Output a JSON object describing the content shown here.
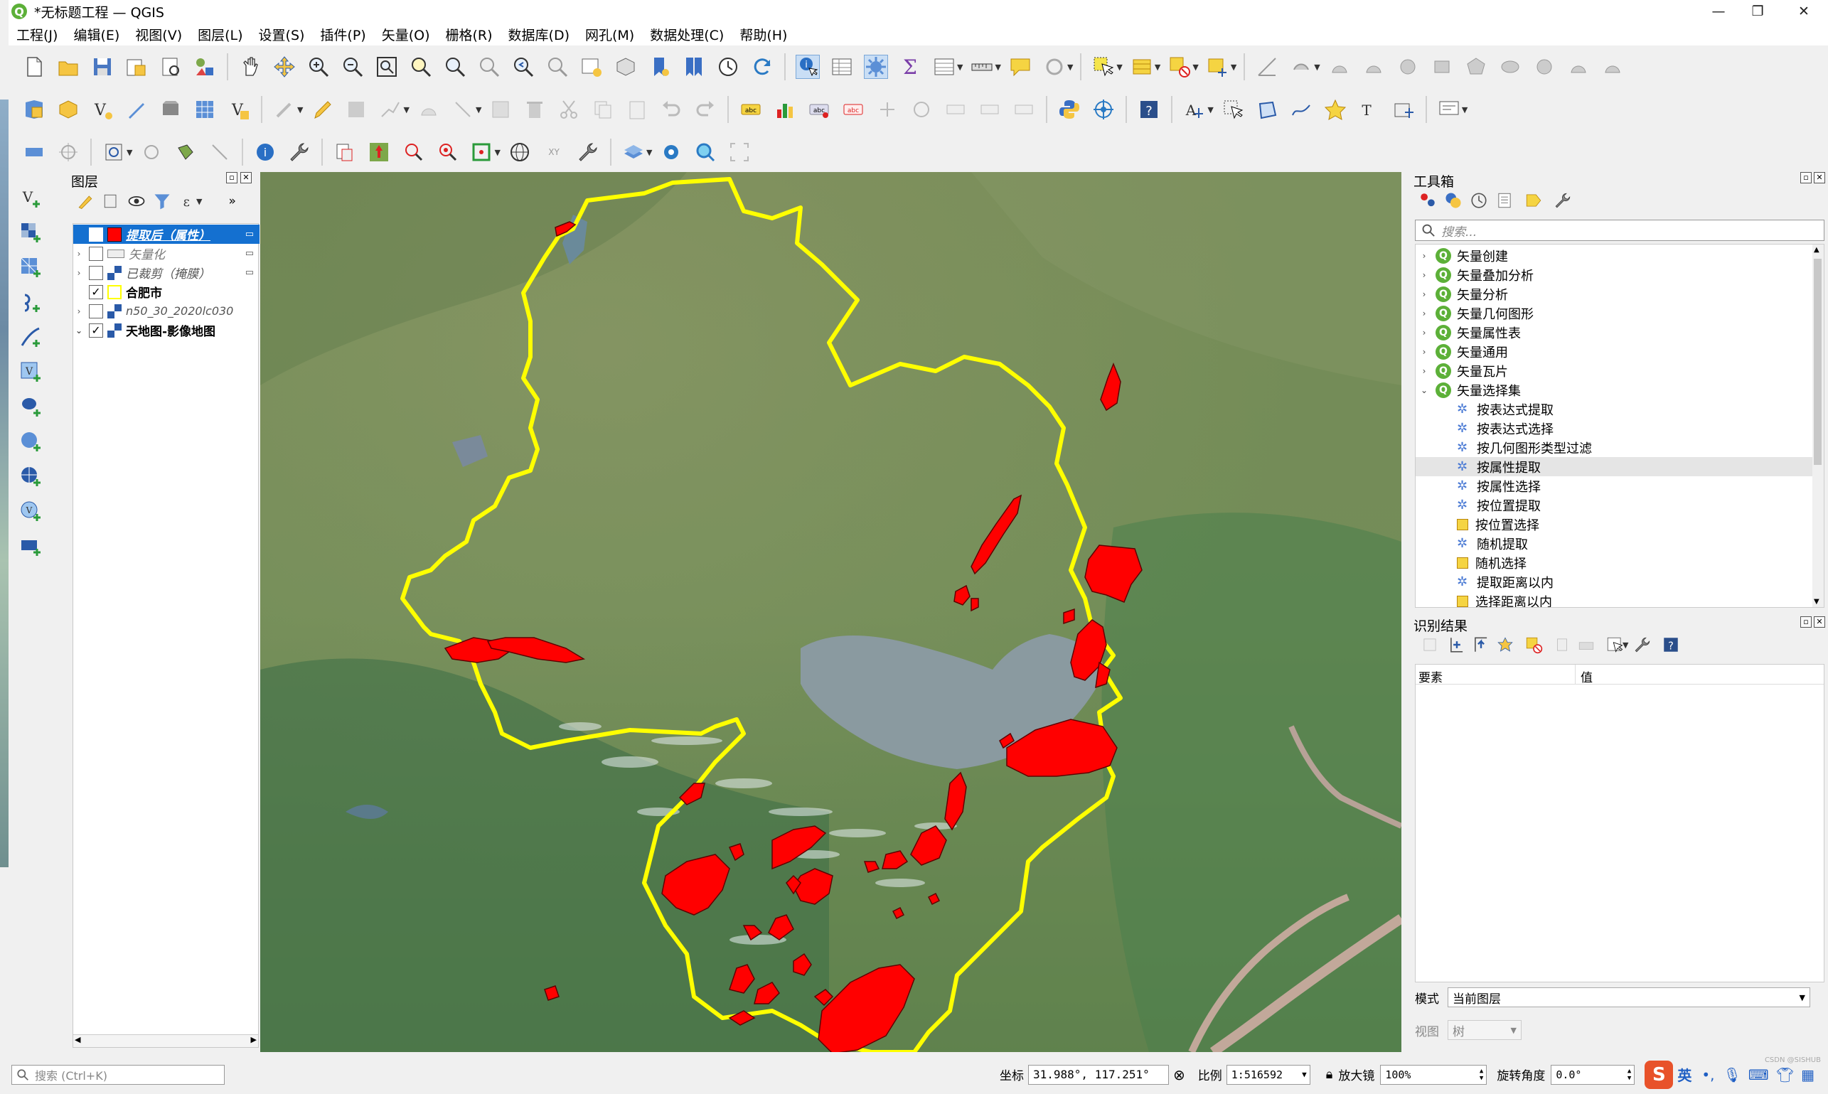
{
  "window": {
    "title": "*无标题工程 — QGIS",
    "min": "—",
    "max": "❐",
    "close": "✕"
  },
  "menu": [
    "工程(J)",
    "编辑(E)",
    "视图(V)",
    "图层(L)",
    "设置(S)",
    "插件(P)",
    "矢量(O)",
    "栅格(R)",
    "数据库(D)",
    "网孔(M)",
    "数据处理(C)",
    "帮助(H)"
  ],
  "layers_panel": {
    "title": "图层",
    "items": [
      {
        "name": "提取后（属性）",
        "checked": true,
        "selected": true,
        "color": "#ff0000"
      },
      {
        "name": "矢量化",
        "checked": false,
        "italic": true
      },
      {
        "name": "已裁剪（掩膜）",
        "checked": false,
        "italic": true
      },
      {
        "name": "合肥市",
        "checked": true,
        "bold": true,
        "color": "#ffff00"
      },
      {
        "name": "n50_30_2020lc030",
        "checked": false,
        "italic": true
      },
      {
        "name": "天地图-影像地图",
        "checked": true,
        "bold": true
      }
    ]
  },
  "toolbox": {
    "title": "工具箱",
    "search_placeholder": "搜索...",
    "groups": [
      "矢量创建",
      "矢量叠加分析",
      "矢量分析",
      "矢量几何图形",
      "矢量属性表",
      "矢量通用",
      "矢量瓦片",
      "矢量选择集"
    ],
    "tools": [
      "按表达式提取",
      "按表达式选择",
      "按几何图形类型过滤",
      "按属性提取",
      "按属性选择",
      "按位置提取",
      "按位置选择",
      "随机提取",
      "随机选择",
      "提取距离以内",
      "选择距离以内"
    ],
    "highlighted_tool": "按属性提取"
  },
  "identify": {
    "title": "识别结果",
    "col_feature": "要素",
    "col_value": "值",
    "mode_label": "模式",
    "mode_value": "当前图层",
    "view_label": "视图",
    "view_value": "树"
  },
  "status": {
    "search_placeholder": "搜索 (Ctrl+K)",
    "coord_label": "坐标",
    "coord_value": "31.988°, 117.251°",
    "scale_label": "比例",
    "scale_value": "1:516592",
    "magnifier_label": "放大镜",
    "magnifier_value": "100%",
    "rotation_label": "旋转角度",
    "rotation_value": "0.0°",
    "ime_text": "英",
    "watermark": "CSDN @SISHUB"
  }
}
